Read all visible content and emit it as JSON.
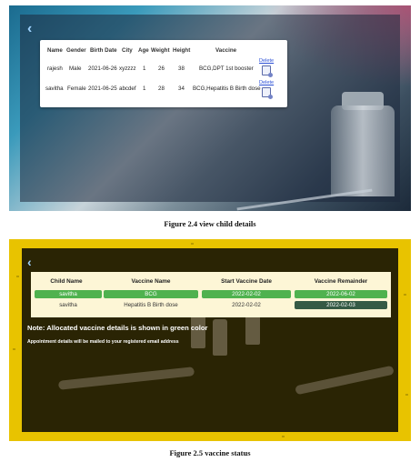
{
  "figure1": {
    "back_icon": "chevron-left-icon",
    "headers": [
      "Name",
      "Gender",
      "Birth Date",
      "City",
      "Age",
      "Weight",
      "Height",
      "Vaccine"
    ],
    "rows": [
      {
        "name": "rajesh",
        "gender": "Male",
        "birth_date": "2021-06-26",
        "city": "xyzzzz",
        "age": "1",
        "weight": "26",
        "height": "38",
        "vaccine": "BCG,DPT 1st booster",
        "delete_label": "Delete"
      },
      {
        "name": "savitha",
        "gender": "Female",
        "birth_date": "2021-06-25",
        "city": "abcdef",
        "age": "1",
        "weight": "28",
        "height": "34",
        "vaccine": "BCG,Hepatitis B Birth dose",
        "delete_label": "Delete"
      }
    ],
    "caption": "Figure 2.4 view child  details"
  },
  "figure2": {
    "back_icon": "chevron-left-icon",
    "headers": [
      "Child Name",
      "Vaccine Name",
      "Start Vaccine Date",
      "Vaccine Remainder"
    ],
    "rows": [
      {
        "child_name": "savitha",
        "vaccine_name": "BCG",
        "start_date": "2022-02-02",
        "remainder": "2022-06-02"
      },
      {
        "child_name": "savitha",
        "vaccine_name": "Hepatitis B Birth dose",
        "start_date": "2022-02-02",
        "remainder": "2022-02-03"
      }
    ],
    "note": "Note: Allocated vaccine details is shown in green color",
    "sub_note": "Appointment details will be mailed to your registered email address",
    "caption": "Figure 2.5 vaccine status",
    "colors": {
      "allocated": "#4fb24f",
      "remainder_dark": "#355a45",
      "background_yellow": "#e8c300"
    }
  }
}
